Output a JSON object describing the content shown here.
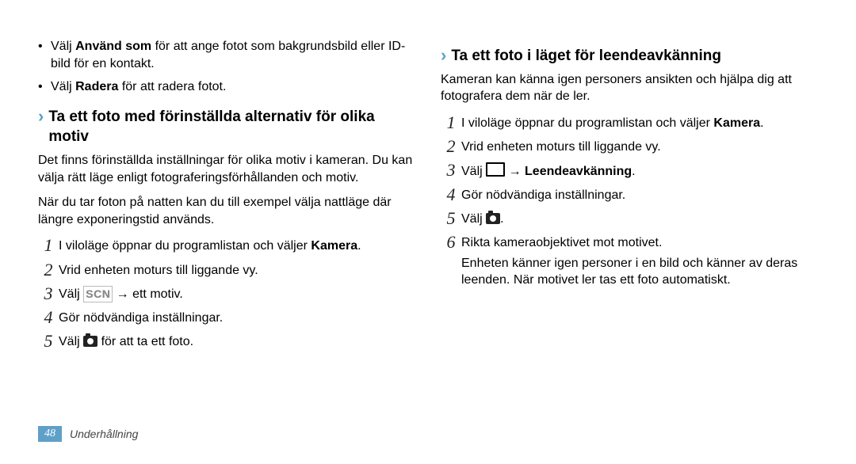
{
  "left": {
    "bullets": [
      {
        "pre": "Välj ",
        "bold": "Använd som",
        "post": " för att ange fotot som bakgrundsbild eller ID-bild för en kontakt."
      },
      {
        "pre": "Välj ",
        "bold": "Radera",
        "post": " för att radera fotot."
      }
    ],
    "heading": "Ta ett foto med förinställda alternativ för olika motiv",
    "paras": [
      "Det finns förinställda inställningar för olika motiv i kameran. Du kan välja rätt läge enligt fotograferingsförhållanden och motiv.",
      "När du tar foton på natten kan du till exempel välja nattläge där längre exponeringstid används."
    ],
    "steps": {
      "s1_pre": "I viloläge öppnar du programlistan och väljer ",
      "s1_bold": "Kamera",
      "s1_post": ".",
      "s2": "Vrid enheten moturs till liggande vy.",
      "s3_pre": "Välj ",
      "s3_post": " → ett motiv.",
      "s4": "Gör nödvändiga inställningar.",
      "s5_pre": "Välj ",
      "s5_post": " för att ta ett foto."
    }
  },
  "right": {
    "heading": "Ta ett foto i läget för leendeavkänning",
    "para": "Kameran kan känna igen personers ansikten och hjälpa dig att fotografera dem när de ler.",
    "steps": {
      "s1_pre": "I viloläge öppnar du programlistan och väljer ",
      "s1_bold": "Kamera",
      "s1_post": ".",
      "s2": "Vrid enheten moturs till liggande vy.",
      "s3_pre": "Välj ",
      "s3_mid": " → ",
      "s3_bold": "Leendeavkänning",
      "s3_post": ".",
      "s4": "Gör nödvändiga inställningar.",
      "s5_pre": "Välj ",
      "s5_post": ".",
      "s6": "Rikta kameraobjektivet mot motivet.",
      "s6_extra": "Enheten känner igen personer i en bild och känner av deras leenden. När motivet ler tas ett foto automatiskt."
    }
  },
  "footer": {
    "page": "48",
    "section": "Underhållning"
  }
}
